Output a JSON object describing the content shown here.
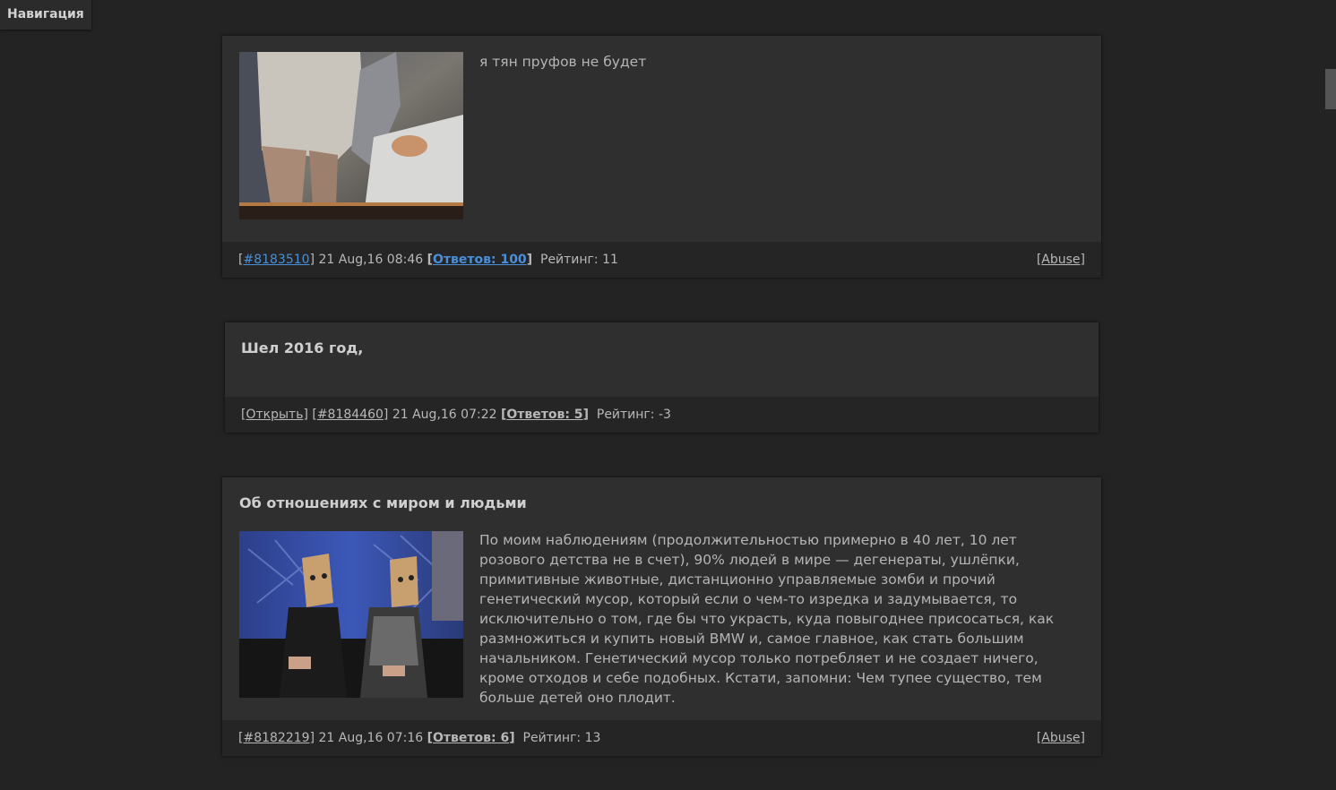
{
  "nav": {
    "label": "Навигация"
  },
  "posts": [
    {
      "title": "",
      "text": "я тян пруфов не будет",
      "open_label": "",
      "id_link": "#8183510",
      "date": "21 Aug,16 08:46",
      "replies": "Ответов: 100",
      "rating": "Рейтинг: 11",
      "abuse": "Abuse"
    },
    {
      "title": "Шел 2016 год,",
      "text": "",
      "open_label": "Открыть",
      "id_link": "#8184460",
      "date": "21 Aug,16 07:22",
      "replies": "Ответов: 5",
      "rating": "Рейтинг: -3",
      "abuse": ""
    },
    {
      "title": "Об отношениях с миром и людьми",
      "text": "По моим наблюдениям (продолжительностью примерно в 40 лет, 10 лет розового детства не в счет), 90% людей в мире — дегенераты, ушлёпки, примитивные животные, дистанционно управляемые зомби и прочий генетический мусор, который если о чем-то изредка и задумывается, то исключительно о том, где бы что украсть, куда повыгоднее присосаться, как размножиться и купить новый BMW и, самое главное, как стать большим начальником. Генетический мусор только потребляет и не создает ничего, кроме отходов и себе подобных. Кстати, запомни: Чем тупее существо, тем больше детей оно плодит.",
      "open_label": "",
      "id_link": "#8182219",
      "date": "21 Aug,16 07:16",
      "replies": "Ответов: 6",
      "rating": "Рейтинг: 13",
      "abuse": "Abuse"
    }
  ],
  "colors": {
    "background": "#232323",
    "post_bg": "#2f2f2f",
    "footer_bg": "#252525",
    "link_blue": "#4a8fd8"
  }
}
